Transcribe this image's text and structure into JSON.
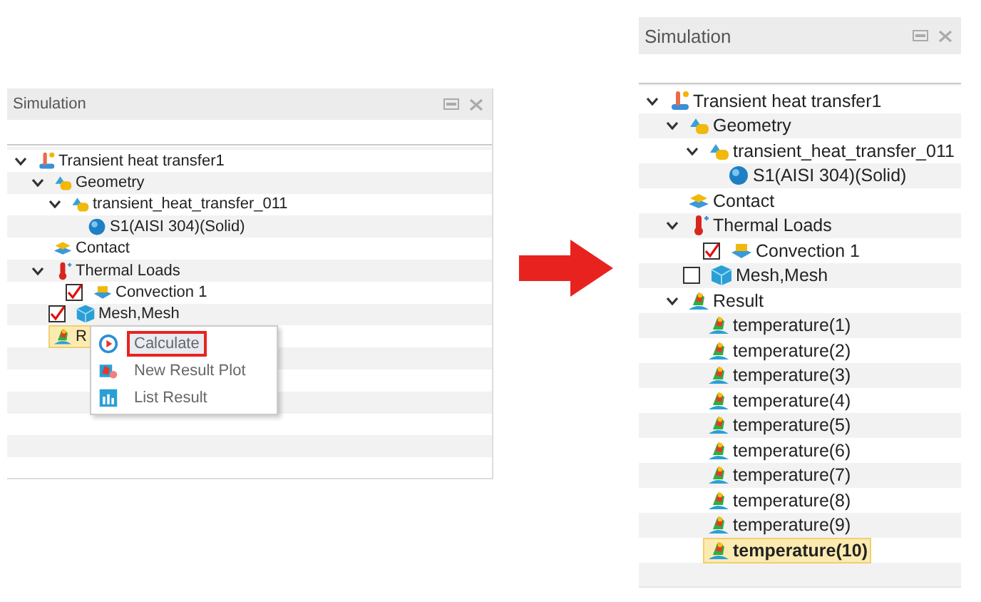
{
  "panels": [
    {
      "title": "Simulation",
      "tree": [
        {
          "label": "Transient heat transfer1",
          "kind": "study",
          "expanded": true,
          "selected": false,
          "children": [
            {
              "label": "Geometry",
              "kind": "geometry",
              "expanded": true,
              "selected": false,
              "children": [
                {
                  "label": "transient_heat_transfer_011",
                  "kind": "geometry",
                  "expanded": true,
                  "selected": false,
                  "children": [
                    {
                      "label": "S1(AISI 304)(Solid)",
                      "kind": "solid",
                      "selected": false
                    }
                  ]
                }
              ]
            },
            {
              "label": "Contact",
              "kind": "contact",
              "selected": false
            },
            {
              "label": "Thermal Loads",
              "kind": "thermal",
              "expanded": true,
              "selected": false,
              "children": [
                {
                  "label": "Convection 1",
                  "kind": "convection",
                  "checked": true,
                  "selected": false
                }
              ]
            },
            {
              "label": "Mesh,Mesh",
              "kind": "mesh",
              "checked": true,
              "selected": false
            },
            {
              "label": "R",
              "kind": "result",
              "selected": true
            }
          ]
        }
      ],
      "context_menu": {
        "items": [
          {
            "label": "Calculate",
            "kind": "calculate",
            "highlighted": true
          },
          {
            "label": "New Result Plot",
            "kind": "plot",
            "highlighted": false
          },
          {
            "label": "List Result",
            "kind": "list",
            "highlighted": false
          }
        ]
      }
    },
    {
      "title": "Simulation",
      "tree": [
        {
          "label": "Transient heat transfer1",
          "kind": "study",
          "expanded": true,
          "selected": false,
          "children": [
            {
              "label": "Geometry",
              "kind": "geometry",
              "expanded": true,
              "selected": false,
              "children": [
                {
                  "label": "transient_heat_transfer_011",
                  "kind": "geometry",
                  "expanded": true,
                  "selected": false,
                  "children": [
                    {
                      "label": "S1(AISI 304)(Solid)",
                      "kind": "solid",
                      "selected": false
                    }
                  ]
                }
              ]
            },
            {
              "label": "Contact",
              "kind": "contact",
              "selected": false
            },
            {
              "label": "Thermal Loads",
              "kind": "thermal",
              "expanded": true,
              "selected": false,
              "children": [
                {
                  "label": "Convection 1",
                  "kind": "convection",
                  "checked": true,
                  "selected": false
                }
              ]
            },
            {
              "label": "Mesh,Mesh",
              "kind": "mesh",
              "checked": false,
              "selected": false
            },
            {
              "label": "Result",
              "kind": "result",
              "expanded": true,
              "selected": false,
              "children": [
                {
                  "label": "temperature(1)",
                  "kind": "result",
                  "selected": false
                },
                {
                  "label": "temperature(2)",
                  "kind": "result",
                  "selected": false
                },
                {
                  "label": "temperature(3)",
                  "kind": "result",
                  "selected": false
                },
                {
                  "label": "temperature(4)",
                  "kind": "result",
                  "selected": false
                },
                {
                  "label": "temperature(5)",
                  "kind": "result",
                  "selected": false
                },
                {
                  "label": "temperature(6)",
                  "kind": "result",
                  "selected": false
                },
                {
                  "label": "temperature(7)",
                  "kind": "result",
                  "selected": false
                },
                {
                  "label": "temperature(8)",
                  "kind": "result",
                  "selected": false
                },
                {
                  "label": "temperature(9)",
                  "kind": "result",
                  "selected": false
                },
                {
                  "label": "temperature(10)",
                  "kind": "result",
                  "selected": true
                }
              ]
            }
          ]
        }
      ]
    }
  ]
}
